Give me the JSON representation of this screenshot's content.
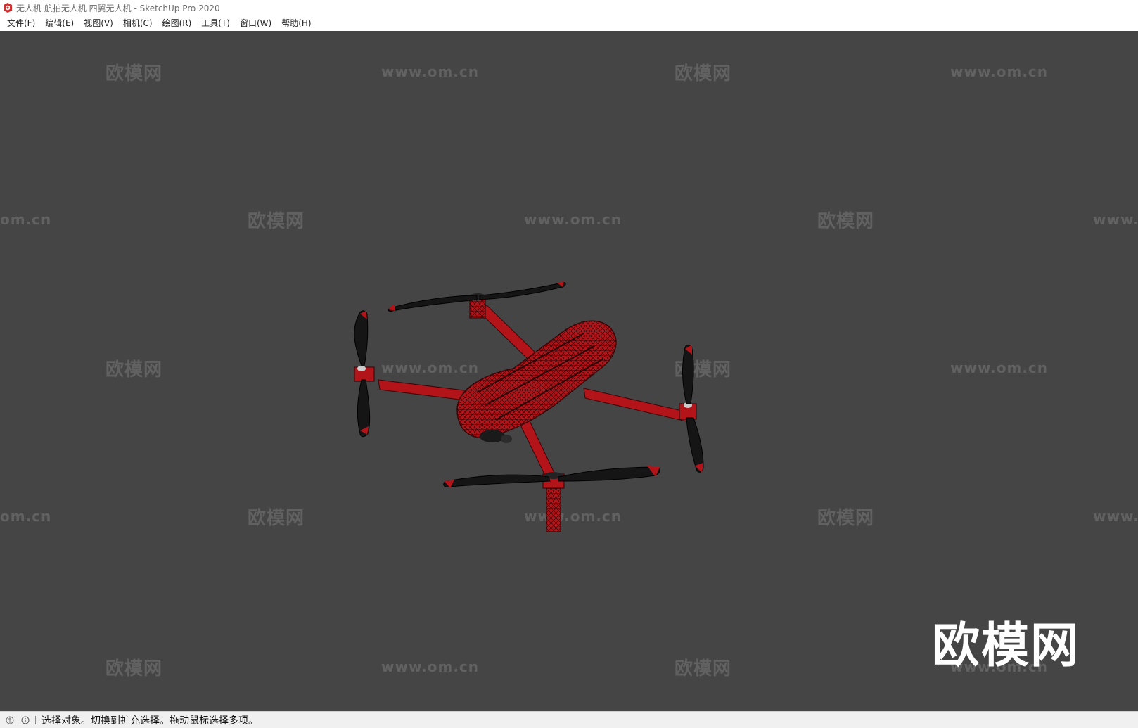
{
  "window": {
    "title": "无人机 航拍无人机 四翼无人机 - SketchUp Pro 2020",
    "icon": "sketchup-logo-icon"
  },
  "menubar": {
    "items": [
      {
        "label": "文件(F)"
      },
      {
        "label": "编辑(E)"
      },
      {
        "label": "视图(V)"
      },
      {
        "label": "相机(C)"
      },
      {
        "label": "绘图(R)"
      },
      {
        "label": "工具(T)"
      },
      {
        "label": "窗口(W)"
      },
      {
        "label": "帮助(H)"
      }
    ]
  },
  "viewport": {
    "background": "#454545",
    "model_color": "#b3141a",
    "propeller_color": "#151515",
    "watermarks": {
      "brand": "欧模网",
      "url": "www.om.cn",
      "url_left_clip": "om.cn",
      "url_right_clip": "www."
    },
    "big_watermark": "欧模网"
  },
  "statusbar": {
    "icons": [
      "geo-location-icon",
      "info-icon"
    ],
    "message": "选择对象。切换到扩充选择。拖动鼠标选择多项。"
  }
}
